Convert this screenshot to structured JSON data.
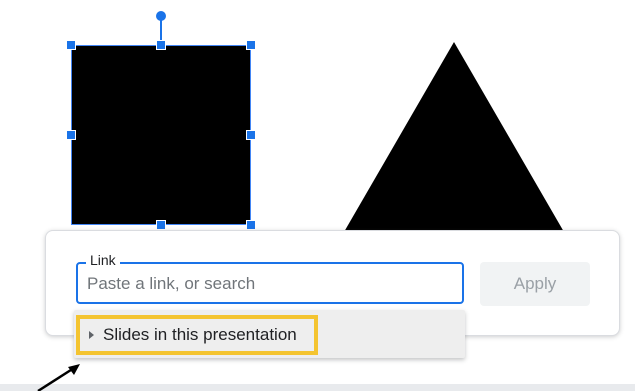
{
  "canvas": {
    "shapes": [
      {
        "kind": "rectangle",
        "fill": "#000000",
        "selected": true
      },
      {
        "kind": "triangle",
        "fill": "#000000",
        "selected": false
      }
    ],
    "selection_color": "#1a73e8"
  },
  "link_popup": {
    "field_label": "Link",
    "input_value": "",
    "input_placeholder": "Paste a link, or search",
    "apply_label": "Apply",
    "accent_color": "#1a73e8"
  },
  "suggestions": {
    "items": [
      {
        "label": "Slides in this presentation",
        "icon": "caret-right-icon",
        "highlight_color": "#f4c430"
      }
    ]
  },
  "annotation": {
    "icon": "pointer-arrow-icon"
  }
}
